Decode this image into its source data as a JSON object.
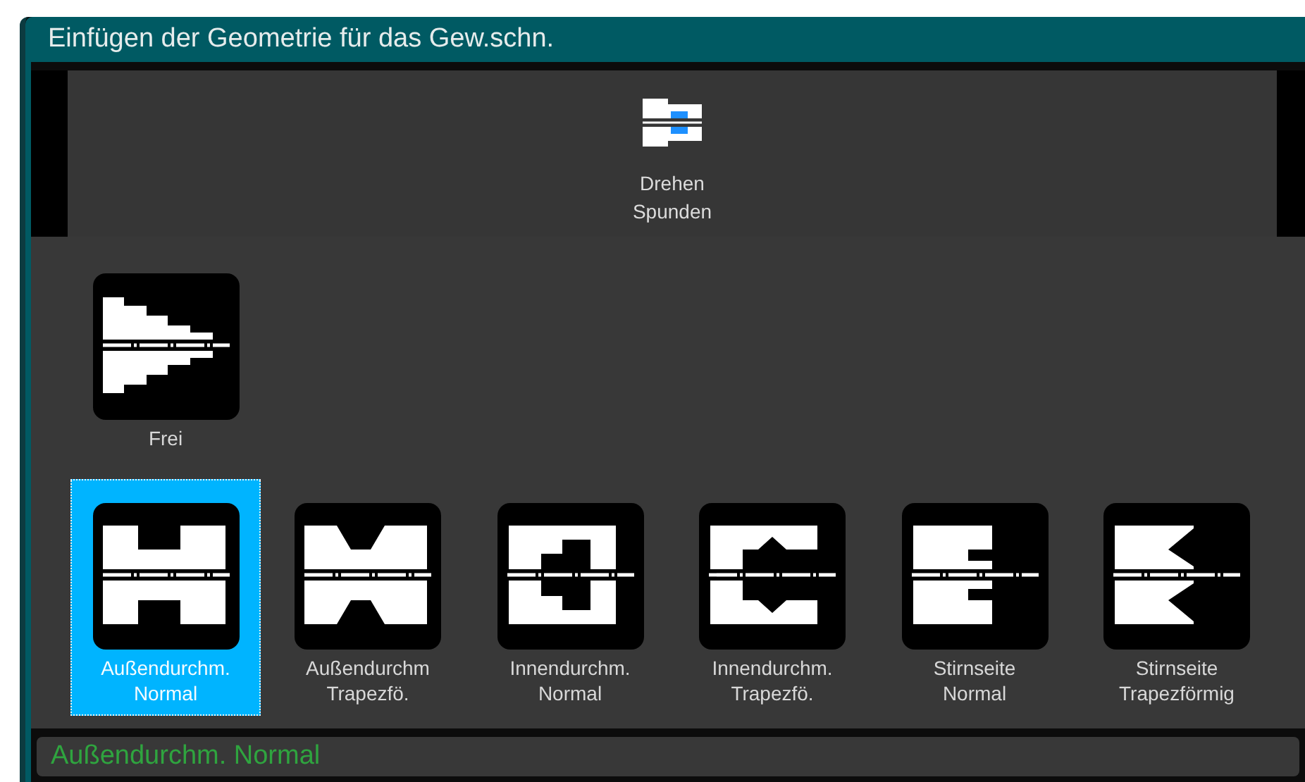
{
  "window": {
    "title": "Einfügen der Geometrie für das Gew.schn."
  },
  "top_tool": {
    "lines": [
      "Drehen",
      "Spunden"
    ]
  },
  "free_tiles": [
    {
      "lines": [
        "Frei"
      ],
      "kind": "stepped",
      "selected": false
    }
  ],
  "options": [
    {
      "lines": [
        "Außendurchm.",
        "Normal"
      ],
      "kind": "outer-normal",
      "selected": true
    },
    {
      "lines": [
        "Außendurchm",
        "Trapezfö."
      ],
      "kind": "outer-trapezoid",
      "selected": false
    },
    {
      "lines": [
        "Innendurchm.",
        "Normal"
      ],
      "kind": "inner-normal",
      "selected": false
    },
    {
      "lines": [
        "Innendurchm.",
        "Trapezfö."
      ],
      "kind": "inner-trapezoid",
      "selected": false
    },
    {
      "lines": [
        "Stirnseite",
        "Normal"
      ],
      "kind": "face-normal",
      "selected": false
    },
    {
      "lines": [
        "Stirnseite",
        "Trapezförmig"
      ],
      "kind": "face-trapezoid",
      "selected": false
    }
  ],
  "status_bar": {
    "text": "Außendurchm. Normal"
  }
}
